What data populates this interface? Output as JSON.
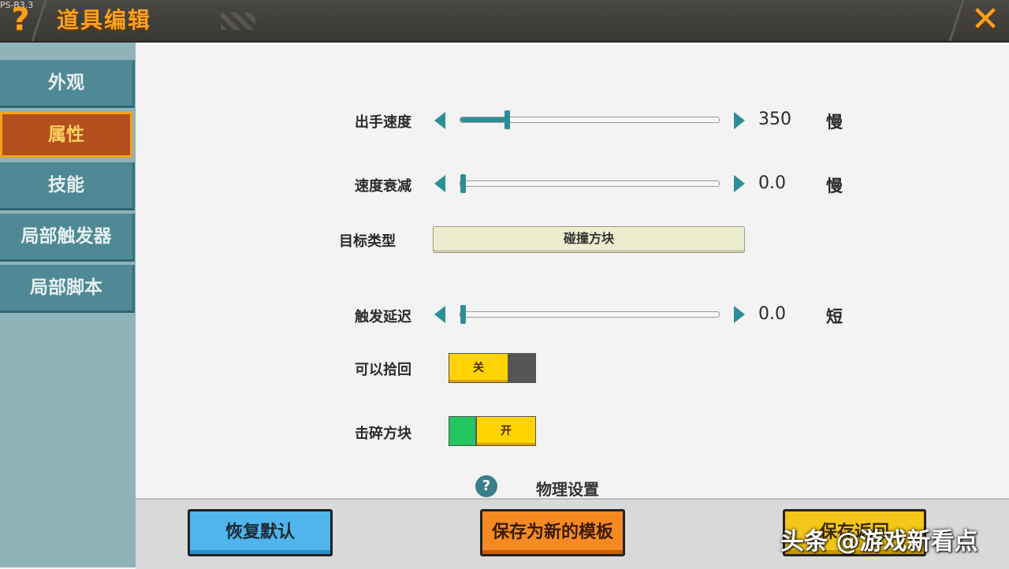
{
  "header": {
    "version": "PS-B3.3",
    "help_icon": "?",
    "title": "道具编辑",
    "close_icon": "✕"
  },
  "sidebar": {
    "items": [
      {
        "label": "外观",
        "active": false
      },
      {
        "label": "属性",
        "active": true
      },
      {
        "label": "技能",
        "active": false
      },
      {
        "label": "局部触发器",
        "active": false
      },
      {
        "label": "局部脚本",
        "active": false
      }
    ]
  },
  "settings": {
    "throw_speed": {
      "label": "出手速度",
      "value": "350",
      "unit": "慢",
      "level": 0.18
    },
    "speed_decay": {
      "label": "速度衰减",
      "value": "0.0",
      "unit": "慢",
      "level": 0.0
    },
    "target_type": {
      "label": "目标类型",
      "value": "碰撞方块"
    },
    "trigger_delay": {
      "label": "触发延迟",
      "value": "0.0",
      "unit": "短",
      "level": 0.0
    },
    "can_pickup": {
      "label": "可以拾回",
      "state": "关"
    },
    "break_blocks": {
      "label": "击碎方块",
      "state": "开"
    },
    "section": {
      "help": "?",
      "title": "物理设置"
    }
  },
  "footer": {
    "reset_label": "恢复默认",
    "template_label": "保存为新的模板",
    "save_label": "保存返回"
  },
  "watermark": "头条 @游戏新看点",
  "colors": {
    "accent": "#f7a21e",
    "teal": "#2c8f97",
    "toggle_on": "#ffd400",
    "green": "#22c55e",
    "gray": "#555555"
  }
}
